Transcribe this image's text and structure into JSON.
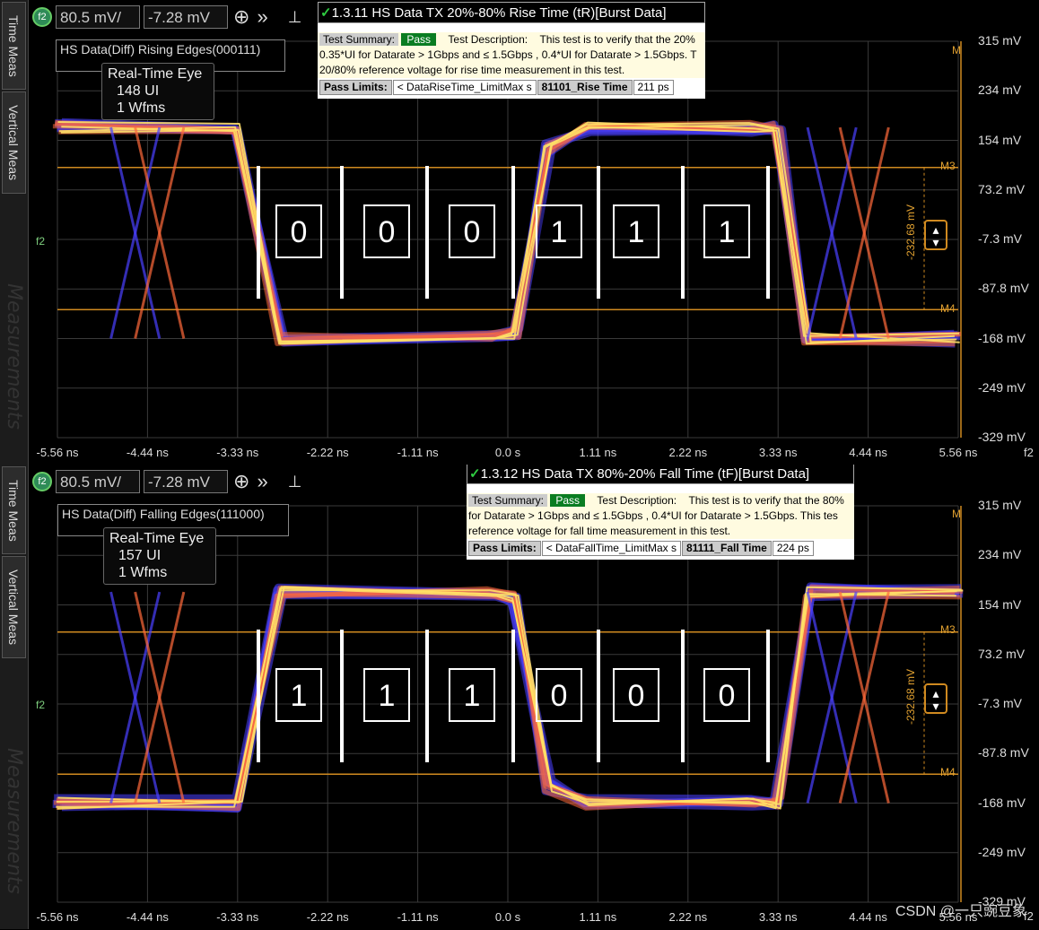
{
  "toolbar": {
    "channel": "f2",
    "scale": "80.5 mV/",
    "offset": "-7.28 mV",
    "add_icon": "plus-circle-icon",
    "more_icon": "double-chevron-icon",
    "pin_icon": "pin-icon"
  },
  "side_tabs": [
    "Time Meas",
    "Vertical Meas",
    "Measurements"
  ],
  "colors": {
    "grid": "#3a3a3a",
    "cursor": "#d08a20",
    "trace_hot": "#ffe066",
    "trace_mid": "#ff6a3a",
    "trace_cold": "#4a40ff"
  },
  "axes": {
    "x_ticks": [
      "-5.56 ns",
      "-4.44 ns",
      "-3.33 ns",
      "-2.22 ns",
      "-1.11 ns",
      "0.0 s",
      "1.11 ns",
      "2.22 ns",
      "3.33 ns",
      "4.44 ns",
      "5.56 ns"
    ],
    "y_ticks": [
      "315 mV",
      "234 mV",
      "154 mV",
      "73.2 mV",
      "-7.3 mV",
      "-87.8 mV",
      "-168 mV",
      "-249 mV",
      "-329 mV"
    ],
    "corner_label": "f2",
    "channel_marker": "f2"
  },
  "panels": [
    {
      "label": "HS Data(Diff) Rising Edges(000111)",
      "eye": {
        "line1": "Real-Time Eye",
        "line2": "148 UI",
        "line3": "1 Wfms"
      },
      "test": {
        "title": "1.3.11 HS Data TX 20%-80% Rise Time (tR)[Burst Data]",
        "summary_label": "Test Summary:",
        "status": "Pass",
        "desc_label": "Test Description:",
        "desc1": "This test is to verify that the 20%",
        "desc2": "0.35*UI for Datarate > 1Gbps and ≤ 1.5Gbps , 0.4*UI for Datarate > 1.5Gbps. T",
        "desc3": "20/80% reference voltage for rise time measurement in this test.",
        "limits_label": "Pass Limits:",
        "limit": "< DataRiseTime_LimitMax s",
        "meas_name": "81101_Rise Time",
        "meas_value": "211 ps"
      },
      "bits": [
        "0",
        "0",
        "0",
        "1",
        "1",
        "1"
      ],
      "cursors": {
        "m_top": "M",
        "m3": "M3",
        "m4": "M4",
        "delta": "-232.68 mV"
      }
    },
    {
      "label": "HS Data(Diff) Falling Edges(111000)",
      "eye": {
        "line1": "Real-Time Eye",
        "line2": "157 UI",
        "line3": "1 Wfms"
      },
      "test": {
        "title": "1.3.12 HS Data TX 80%-20% Fall Time (tF)[Burst Data]",
        "summary_label": "Test Summary:",
        "status": "Pass",
        "desc_label": "Test Description:",
        "desc1": "This test is to verify that the 80%",
        "desc2": "for Datarate > 1Gbps and ≤ 1.5Gbps , 0.4*UI for Datarate > 1.5Gbps. This tes",
        "desc3": "reference voltage for fall time measurement in this test.",
        "limits_label": "Pass Limits:",
        "limit": "< DataFallTime_LimitMax s",
        "meas_name": "81111_Fall Time",
        "meas_value": "224 ps"
      },
      "bits": [
        "1",
        "1",
        "1",
        "0",
        "0",
        "0"
      ],
      "cursors": {
        "m_top": "M",
        "m3": "M3",
        "m4": "M4",
        "delta": "-232.68 mV"
      }
    }
  ],
  "chart_data": [
    {
      "type": "line",
      "title": "HS Data(Diff) Rising Edges(000111)",
      "xlabel": "",
      "ylabel": "",
      "x_unit": "ns",
      "y_unit": "mV",
      "xlim": [
        -5.56,
        5.56
      ],
      "ylim": [
        -329,
        315
      ],
      "grid": true,
      "series": [
        {
          "name": "",
          "x": [
            -5.56,
            -3.33,
            -2.8,
            -0.2,
            0.1,
            0.5,
            1.0,
            3.0,
            3.33,
            3.7,
            5.56
          ],
          "y": [
            175,
            175,
            -168,
            -168,
            -160,
            140,
            175,
            175,
            175,
            -168,
            -168
          ]
        }
      ],
      "cursors_mV": {
        "M3": 110,
        "M4": -121,
        "delta": -232.68
      },
      "measurement": {
        "name": "81101_Rise Time",
        "value_ps": 211
      }
    },
    {
      "type": "line",
      "title": "HS Data(Diff) Falling Edges(111000)",
      "xlabel": "",
      "ylabel": "",
      "x_unit": "ns",
      "y_unit": "mV",
      "xlim": [
        -5.56,
        5.56
      ],
      "ylim": [
        -329,
        315
      ],
      "grid": true,
      "series": [
        {
          "name": "",
          "x": [
            -5.56,
            -3.33,
            -2.8,
            -0.2,
            0.1,
            0.5,
            1.0,
            3.0,
            3.33,
            3.7,
            5.56
          ],
          "y": [
            -168,
            -168,
            175,
            175,
            165,
            -140,
            -168,
            -168,
            -168,
            175,
            175
          ]
        }
      ],
      "cursors_mV": {
        "M3": 110,
        "M4": -121,
        "delta": -232.68
      },
      "measurement": {
        "name": "81111_Fall Time",
        "value_ps": 224
      }
    }
  ],
  "watermark": "CSDN @一只豌豆象"
}
